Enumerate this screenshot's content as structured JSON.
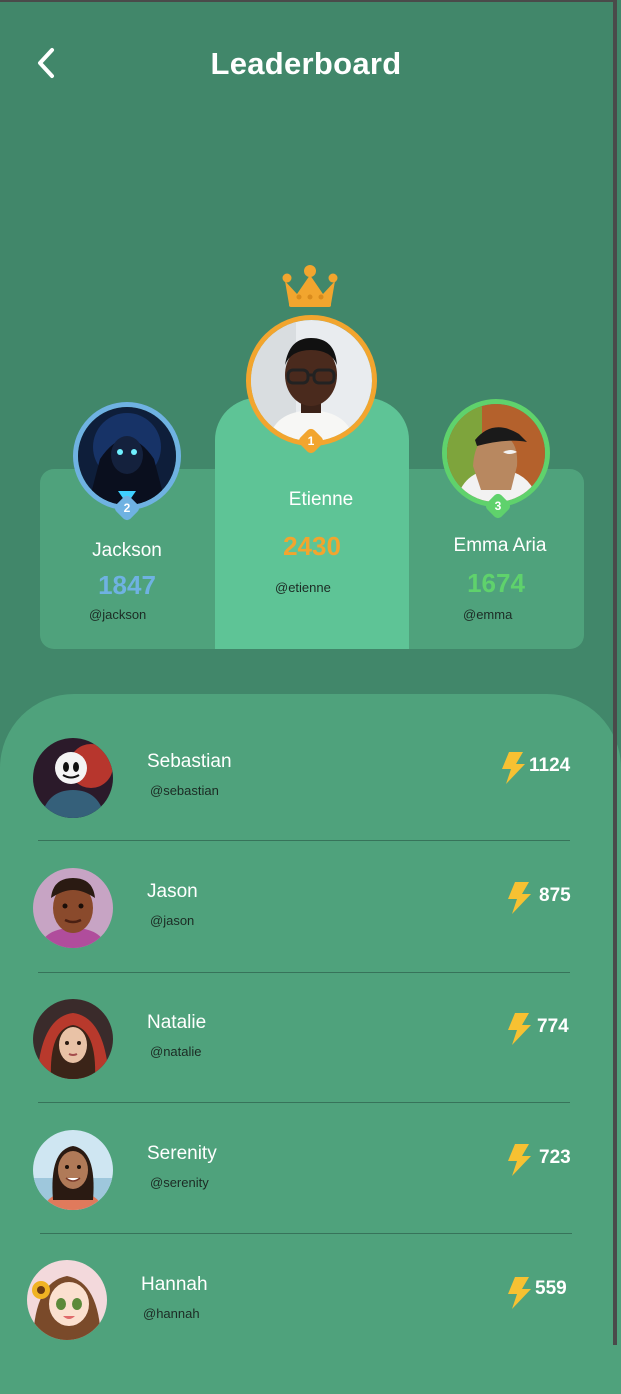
{
  "header": {
    "title": "Leaderboard",
    "back_icon": "chevron-left-icon"
  },
  "colors": {
    "background": "#41876a",
    "panel": "#4fa27c",
    "winner_panel": "#5ec496",
    "gold": "#f2a52e",
    "silver_blue": "#6fb2e2",
    "green": "#5fd26c",
    "bolt": "#f7c132"
  },
  "podium": {
    "first": {
      "rank": "1",
      "name": "Etienne",
      "score": "2430",
      "handle": "@etienne"
    },
    "second": {
      "rank": "2",
      "name": "Jackson",
      "score": "1847",
      "handle": "@jackson"
    },
    "third": {
      "rank": "3",
      "name": "Emma Aria",
      "score": "1674",
      "handle": "@emma"
    }
  },
  "list": [
    {
      "name": "Sebastian",
      "handle": "@sebastian",
      "score": "1124"
    },
    {
      "name": "Jason",
      "handle": "@jason",
      "score": "875"
    },
    {
      "name": "Natalie",
      "handle": "@natalie",
      "score": "774"
    },
    {
      "name": "Serenity",
      "handle": "@serenity",
      "score": "723"
    },
    {
      "name": "Hannah",
      "handle": "@hannah",
      "score": "559"
    }
  ],
  "icons": {
    "crown": "crown-icon",
    "points": "lightning-bolt-icon"
  }
}
